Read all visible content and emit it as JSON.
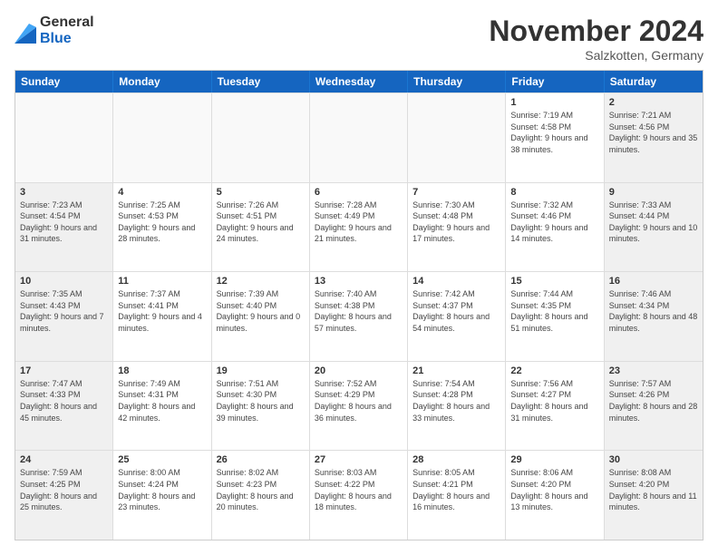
{
  "logo": {
    "general": "General",
    "blue": "Blue"
  },
  "title": "November 2024",
  "location": "Salzkotten, Germany",
  "header": {
    "days": [
      "Sunday",
      "Monday",
      "Tuesday",
      "Wednesday",
      "Thursday",
      "Friday",
      "Saturday"
    ]
  },
  "rows": [
    [
      {
        "day": "",
        "info": ""
      },
      {
        "day": "",
        "info": ""
      },
      {
        "day": "",
        "info": ""
      },
      {
        "day": "",
        "info": ""
      },
      {
        "day": "",
        "info": ""
      },
      {
        "day": "1",
        "info": "Sunrise: 7:19 AM\nSunset: 4:58 PM\nDaylight: 9 hours\nand 38 minutes."
      },
      {
        "day": "2",
        "info": "Sunrise: 7:21 AM\nSunset: 4:56 PM\nDaylight: 9 hours\nand 35 minutes."
      }
    ],
    [
      {
        "day": "3",
        "info": "Sunrise: 7:23 AM\nSunset: 4:54 PM\nDaylight: 9 hours\nand 31 minutes."
      },
      {
        "day": "4",
        "info": "Sunrise: 7:25 AM\nSunset: 4:53 PM\nDaylight: 9 hours\nand 28 minutes."
      },
      {
        "day": "5",
        "info": "Sunrise: 7:26 AM\nSunset: 4:51 PM\nDaylight: 9 hours\nand 24 minutes."
      },
      {
        "day": "6",
        "info": "Sunrise: 7:28 AM\nSunset: 4:49 PM\nDaylight: 9 hours\nand 21 minutes."
      },
      {
        "day": "7",
        "info": "Sunrise: 7:30 AM\nSunset: 4:48 PM\nDaylight: 9 hours\nand 17 minutes."
      },
      {
        "day": "8",
        "info": "Sunrise: 7:32 AM\nSunset: 4:46 PM\nDaylight: 9 hours\nand 14 minutes."
      },
      {
        "day": "9",
        "info": "Sunrise: 7:33 AM\nSunset: 4:44 PM\nDaylight: 9 hours\nand 10 minutes."
      }
    ],
    [
      {
        "day": "10",
        "info": "Sunrise: 7:35 AM\nSunset: 4:43 PM\nDaylight: 9 hours\nand 7 minutes."
      },
      {
        "day": "11",
        "info": "Sunrise: 7:37 AM\nSunset: 4:41 PM\nDaylight: 9 hours\nand 4 minutes."
      },
      {
        "day": "12",
        "info": "Sunrise: 7:39 AM\nSunset: 4:40 PM\nDaylight: 9 hours\nand 0 minutes."
      },
      {
        "day": "13",
        "info": "Sunrise: 7:40 AM\nSunset: 4:38 PM\nDaylight: 8 hours\nand 57 minutes."
      },
      {
        "day": "14",
        "info": "Sunrise: 7:42 AM\nSunset: 4:37 PM\nDaylight: 8 hours\nand 54 minutes."
      },
      {
        "day": "15",
        "info": "Sunrise: 7:44 AM\nSunset: 4:35 PM\nDaylight: 8 hours\nand 51 minutes."
      },
      {
        "day": "16",
        "info": "Sunrise: 7:46 AM\nSunset: 4:34 PM\nDaylight: 8 hours\nand 48 minutes."
      }
    ],
    [
      {
        "day": "17",
        "info": "Sunrise: 7:47 AM\nSunset: 4:33 PM\nDaylight: 8 hours\nand 45 minutes."
      },
      {
        "day": "18",
        "info": "Sunrise: 7:49 AM\nSunset: 4:31 PM\nDaylight: 8 hours\nand 42 minutes."
      },
      {
        "day": "19",
        "info": "Sunrise: 7:51 AM\nSunset: 4:30 PM\nDaylight: 8 hours\nand 39 minutes."
      },
      {
        "day": "20",
        "info": "Sunrise: 7:52 AM\nSunset: 4:29 PM\nDaylight: 8 hours\nand 36 minutes."
      },
      {
        "day": "21",
        "info": "Sunrise: 7:54 AM\nSunset: 4:28 PM\nDaylight: 8 hours\nand 33 minutes."
      },
      {
        "day": "22",
        "info": "Sunrise: 7:56 AM\nSunset: 4:27 PM\nDaylight: 8 hours\nand 31 minutes."
      },
      {
        "day": "23",
        "info": "Sunrise: 7:57 AM\nSunset: 4:26 PM\nDaylight: 8 hours\nand 28 minutes."
      }
    ],
    [
      {
        "day": "24",
        "info": "Sunrise: 7:59 AM\nSunset: 4:25 PM\nDaylight: 8 hours\nand 25 minutes."
      },
      {
        "day": "25",
        "info": "Sunrise: 8:00 AM\nSunset: 4:24 PM\nDaylight: 8 hours\nand 23 minutes."
      },
      {
        "day": "26",
        "info": "Sunrise: 8:02 AM\nSunset: 4:23 PM\nDaylight: 8 hours\nand 20 minutes."
      },
      {
        "day": "27",
        "info": "Sunrise: 8:03 AM\nSunset: 4:22 PM\nDaylight: 8 hours\nand 18 minutes."
      },
      {
        "day": "28",
        "info": "Sunrise: 8:05 AM\nSunset: 4:21 PM\nDaylight: 8 hours\nand 16 minutes."
      },
      {
        "day": "29",
        "info": "Sunrise: 8:06 AM\nSunset: 4:20 PM\nDaylight: 8 hours\nand 13 minutes."
      },
      {
        "day": "30",
        "info": "Sunrise: 8:08 AM\nSunset: 4:20 PM\nDaylight: 8 hours\nand 11 minutes."
      }
    ]
  ]
}
